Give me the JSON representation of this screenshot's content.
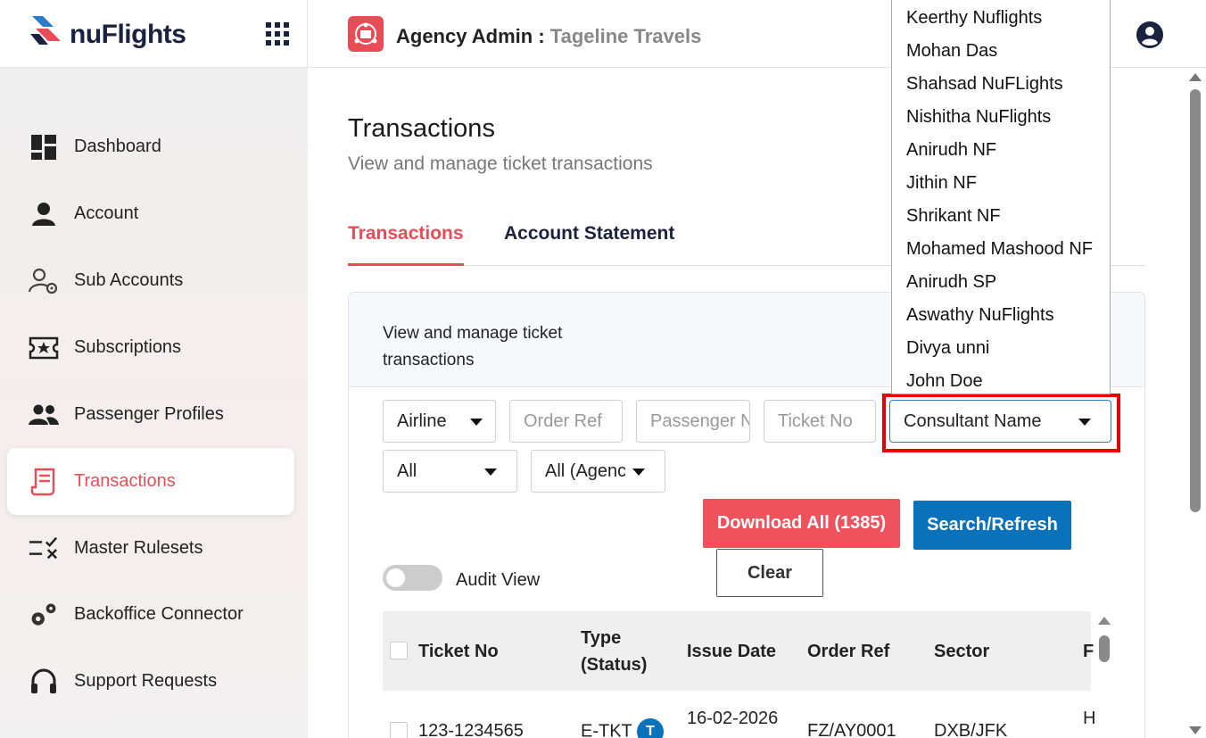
{
  "header": {
    "logo_text": "nuFlights",
    "title_prefix": "Agency Admin :",
    "agency_name": "Tageline Travels"
  },
  "sidebar": {
    "items": [
      {
        "label": "Dashboard",
        "icon": "dashboard-icon"
      },
      {
        "label": "Account",
        "icon": "person-icon"
      },
      {
        "label": "Sub Accounts",
        "icon": "user-gear-icon"
      },
      {
        "label": "Subscriptions",
        "icon": "ticket-star-icon"
      },
      {
        "label": "Passenger Profiles",
        "icon": "people-icon"
      },
      {
        "label": "Transactions",
        "icon": "receipt-icon",
        "active": true
      },
      {
        "label": "Master Rulesets",
        "icon": "checklist-icon"
      },
      {
        "label": "Backoffice Connector",
        "icon": "gears-icon"
      },
      {
        "label": "Support Requests",
        "icon": "headset-icon"
      }
    ]
  },
  "page": {
    "title": "Transactions",
    "subtitle": "View and manage ticket transactions"
  },
  "tabs": [
    {
      "label": "Transactions",
      "active": true
    },
    {
      "label": "Account Statement",
      "active": false
    }
  ],
  "panel": {
    "heading": "View and manage ticket transactions"
  },
  "filters": {
    "airline": "Airline",
    "order_ref_placeholder": "Order Ref",
    "passenger_placeholder": "Passenger Name",
    "ticket_no_placeholder": "Ticket No",
    "consultant": "Consultant Name",
    "status": "All",
    "agency": "All (Agency)"
  },
  "consultant_options": [
    "Keerthy Nuflights",
    "Mohan Das",
    "Shahsad NuFLights",
    "Nishitha NuFlights",
    "Anirudh NF",
    "Jithin NF",
    "Shrikant NF",
    "Mohamed Mashood NF",
    "Anirudh SP",
    "Aswathy NuFlights",
    "Divya unni",
    "John Doe"
  ],
  "actions": {
    "download_label": "Download All (1385)",
    "search_label": "Search/Refresh",
    "clear_label": "Clear",
    "audit_view_label": "Audit View",
    "audit_view_on": false
  },
  "table": {
    "columns": [
      "Ticket No",
      "Type (Status)",
      "Issue Date",
      "Order Ref",
      "Sector",
      "F"
    ],
    "rows": [
      {
        "ticket_no": "123-1234565",
        "type": "E-TKT",
        "status_badge": "T",
        "issue_date": "16-02-2026",
        "order_ref": "FZ/AY0001",
        "sector": "DXB/JFK",
        "extra": "H"
      }
    ]
  },
  "colors": {
    "brand_red": "#e84c56",
    "brand_blue": "#0a72bb",
    "highlight": "#e60000"
  }
}
